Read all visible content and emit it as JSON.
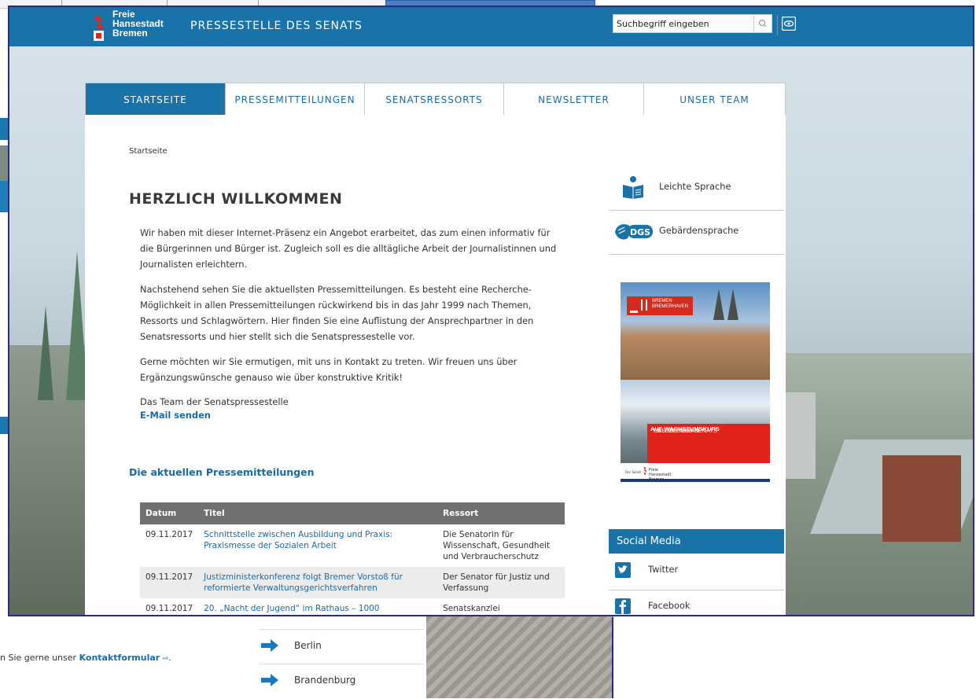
{
  "background": {
    "kontakt_prefix": "n Sie gerne unser",
    "kontakt_link": "Kontaktformular",
    "kontakt_suffix": ".",
    "list_items": [
      "Berlin",
      "Brandenburg"
    ]
  },
  "header": {
    "logo_lines": [
      "Freie",
      "Hansestadt",
      "Bremen"
    ],
    "site_title": "PRESSESTELLE DES SENATS",
    "search_placeholder": "Suchbegriff eingeben"
  },
  "nav": {
    "tabs": [
      {
        "label": "STARTSEITE",
        "active": true
      },
      {
        "label": "PRESSEMITTEILUNGEN",
        "active": false
      },
      {
        "label": "SENATSRESSORTS",
        "active": false
      },
      {
        "label": "NEWSLETTER",
        "active": false
      },
      {
        "label": "UNSER TEAM",
        "active": false
      }
    ]
  },
  "main": {
    "breadcrumb": "Startseite",
    "heading": "HERZLICH WILLKOMMEN",
    "paragraphs": [
      "Wir haben mit dieser Internet-Präsenz ein Angebot erarbeitet, das zum einen informativ für die Bürgerinnen und Bürger ist. Zugleich soll es die alltägliche Arbeit der Journalistinnen und Journalisten erleichtern.",
      "Nachstehend sehen Sie die aktuellsten Pressemitteilungen. Es besteht eine Recherche-Möglichkeit in allen Pressemitteilungen rückwirkend bis in das Jahr 1999 nach Themen, Ressorts und Schlagwörtern. Hier finden Sie eine Auflistung der Ansprechpartner in den Senatsressorts und hier stellt sich die Senatspressestelle vor.",
      "Gerne möchten wir Sie ermutigen, mit uns in Kontakt zu treten. Wir freuen uns über Ergänzungswünsche genauso wie über konstruktive Kritik!",
      "Das Team der Senatspressestelle"
    ],
    "email_link": "E-Mail senden",
    "press_heading": "Die aktuellen Pressemitteilungen",
    "table": {
      "headers": [
        "Datum",
        "Titel",
        "Ressort"
      ],
      "rows": [
        {
          "date": "09.11.2017",
          "title": "Schnittstelle zwischen Ausbildung und Praxis: Praxismesse der Sozialen Arbeit",
          "ressort": "Die Senatorin für Wissenschaft, Gesundheit und Verbraucherschutz"
        },
        {
          "date": "09.11.2017",
          "title": "Justizministerkonferenz folgt Bremer Vorstoß für reformierte Verwaltungsgerichtsverfahren",
          "ressort": "Der Senator für Justiz und Verfassung"
        },
        {
          "date": "09.11.2017",
          "title": "20. „Nacht der Jugend“ im Rathaus – 1000",
          "ressort": "Senatskanzlei"
        }
      ]
    }
  },
  "sidebar": {
    "leichte_sprache": "Leichte Sprache",
    "dgs_badge": "DGS",
    "gebaerdensprache": "Gebärdensprache",
    "banner": {
      "tag_line1": "BREMEN",
      "tag_line2": "BREMERHAVEN",
      "headline_1": "AUF WACHSTUMSKURS",
      "headline_2": "HALBZEITBILANZ",
      "headline_3": "DES BREMER SENATS",
      "footer_left": "Der Senat"
    },
    "social_heading": "Social Media",
    "social": [
      {
        "label": "Twitter",
        "icon": "twitter-icon"
      },
      {
        "label": "Facebook",
        "icon": "facebook-icon"
      }
    ]
  },
  "colors": {
    "brand_blue": "#1a73a8",
    "link_blue": "#1a6aa6",
    "bremen_red": "#d52b1e",
    "table_header": "#707070"
  }
}
